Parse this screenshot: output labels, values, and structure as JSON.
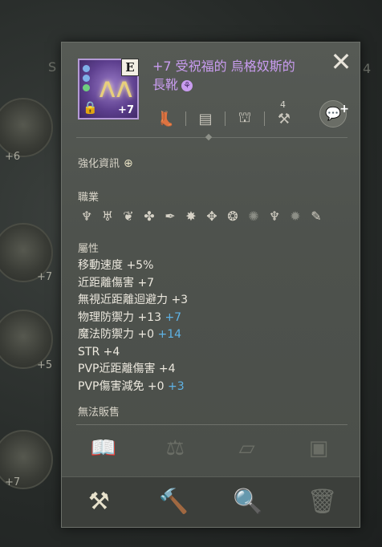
{
  "background": {
    "slot_levels": [
      "+6",
      "+7",
      "+5",
      "+7"
    ],
    "letters": [
      "S",
      "4"
    ]
  },
  "item": {
    "grade_letter": "E",
    "enhance_badge": "+7",
    "name_line1": "+7 受祝福的 烏格奴斯的",
    "name_line2": "長靴",
    "name_color": "#c99cf0",
    "icon": "boots-icon"
  },
  "top_icons": {
    "slot_icon": "boots-slot-icon",
    "chest_icon": "chest-icon",
    "bag_icon": "bag-icon",
    "anvil_count": "4",
    "chat_icon": "chat-icon"
  },
  "sections": {
    "enhance_info": "強化資訊",
    "class_label": "職業",
    "attr_label": "屬性",
    "unsellable": "無法販售"
  },
  "classes": [
    {
      "icon": "class-1-icon",
      "active": true
    },
    {
      "icon": "class-2-icon",
      "active": true
    },
    {
      "icon": "class-3-icon",
      "active": true
    },
    {
      "icon": "class-4-icon",
      "active": true
    },
    {
      "icon": "class-5-icon",
      "active": true
    },
    {
      "icon": "class-6-icon",
      "active": true
    },
    {
      "icon": "class-7-icon",
      "active": true
    },
    {
      "icon": "class-8-icon",
      "active": true
    },
    {
      "icon": "class-9-icon",
      "active": false
    },
    {
      "icon": "class-10-icon",
      "active": true
    },
    {
      "icon": "class-11-icon",
      "active": false
    },
    {
      "icon": "class-12-icon",
      "active": true
    }
  ],
  "stats": [
    {
      "label": "移動速度 +5%",
      "bonus": ""
    },
    {
      "label": "近距離傷害 +7",
      "bonus": ""
    },
    {
      "label": "無視近距離迴避力 +3",
      "bonus": ""
    },
    {
      "label": "物理防禦力 +13",
      "bonus": "+7"
    },
    {
      "label": "魔法防禦力 +0",
      "bonus": "+14"
    },
    {
      "label": "STR +4",
      "bonus": ""
    },
    {
      "label": "PVP近距離傷害 +4",
      "bonus": ""
    },
    {
      "label": "PVP傷害減免 +0",
      "bonus": "+3"
    }
  ],
  "colors": {
    "bonus_blue": "#5fb3e6",
    "panel_bg": "#4e524d"
  }
}
